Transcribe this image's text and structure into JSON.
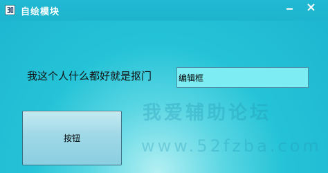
{
  "window": {
    "title": "自绘模块",
    "icon": "app-icon",
    "controls": {
      "minimize_icon": "minimize-icon",
      "close_icon": "close-icon"
    }
  },
  "content": {
    "label": "我这个人什么都好就是抠门",
    "edit_box_value": "编辑框",
    "button_label": "按钮"
  },
  "watermark": {
    "title": "我爱辅助论坛",
    "url": "www.52fzba.com"
  },
  "colors": {
    "background": "#25c3d7",
    "edit_box": "#7eecf3",
    "button": "#9fd8e6"
  }
}
